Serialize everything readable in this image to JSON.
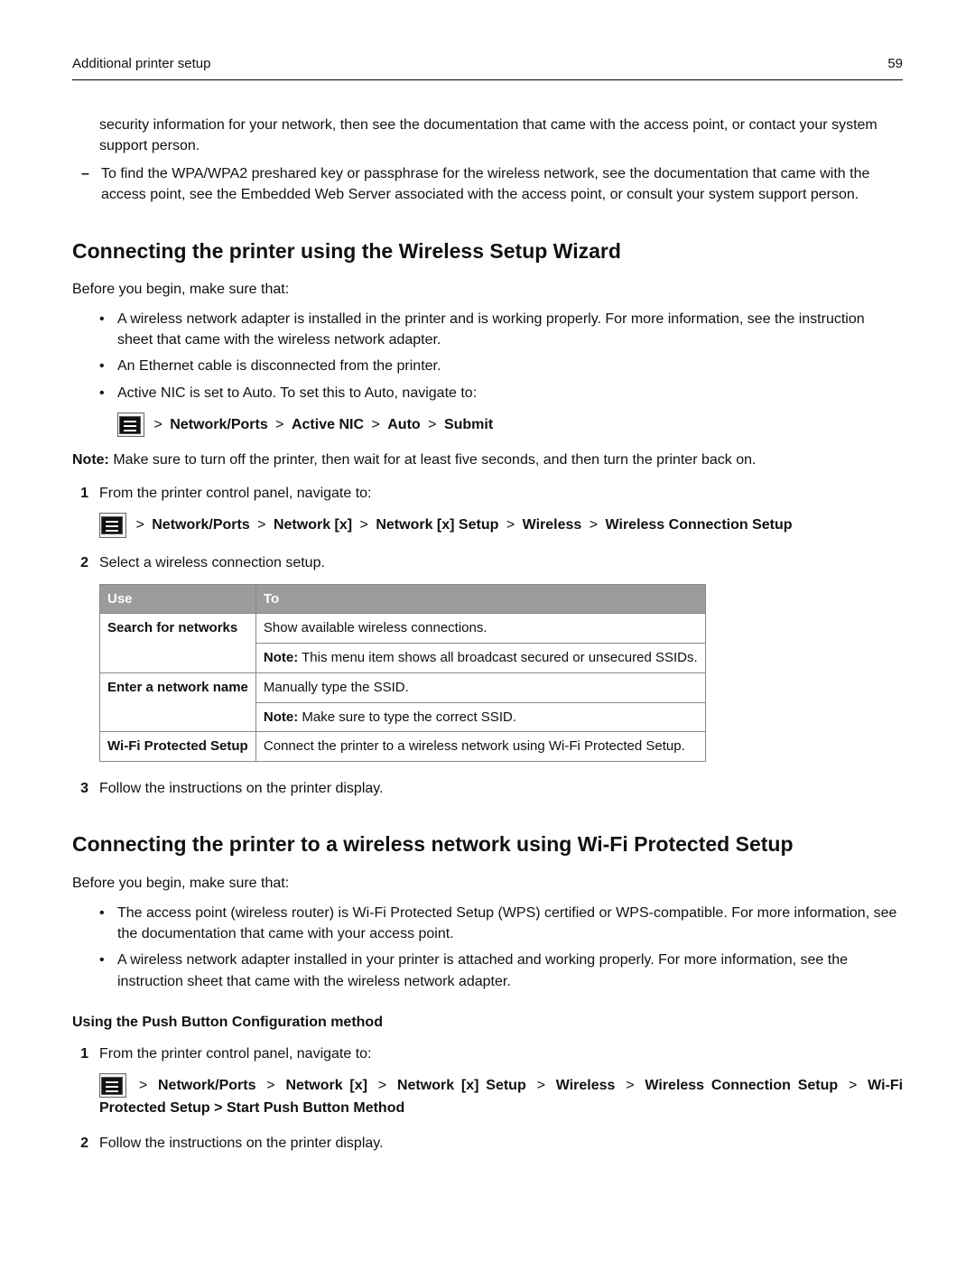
{
  "header": {
    "title": "Additional printer setup",
    "page": "59"
  },
  "intro": {
    "para1": "security information for your network, then see the documentation that came with the access point, or contact your system support person.",
    "dash1": "To find the WPA/WPA2 preshared key or passphrase for the wireless network, see the documentation that came with the access point, see the Embedded Web Server associated with the access point, or consult your system support person."
  },
  "sec1": {
    "heading": "Connecting the printer using the Wireless Setup Wizard",
    "before": "Before you begin, make sure that:",
    "bullets": {
      "b1": "A wireless network adapter is installed in the printer and is working properly. For more information, see the instruction sheet that came with the wireless network adapter.",
      "b2": "An Ethernet cable is disconnected from the printer.",
      "b3": "Active NIC is set to Auto. To set this to Auto, navigate to:"
    },
    "nav1": {
      "p1": "Network/Ports",
      "p2": "Active NIC",
      "p3": "Auto",
      "p4": "Submit"
    },
    "note_label": "Note:",
    "note": " Make sure to turn off the printer, then wait for at least five seconds, and then turn the printer back on.",
    "steps": {
      "s1": "From the printer control panel, navigate to:",
      "s2": "Select a wireless connection setup.",
      "s3": "Follow the instructions on the printer display."
    },
    "nav2": {
      "p1": "Network/Ports",
      "p2": "Network [x]",
      "p3": "Network [x] Setup",
      "p4": "Wireless",
      "p5": "Wireless Connection Setup"
    },
    "table": {
      "h1": "Use",
      "h2": "To",
      "r1c1": "Search for networks",
      "r1c2a": "Show available wireless connections.",
      "r1c2b_label": "Note:",
      "r1c2b": " This menu item shows all broadcast secured or unsecured SSIDs.",
      "r2c1": "Enter a network name",
      "r2c2a": "Manually type the SSID.",
      "r2c2b_label": "Note:",
      "r2c2b": " Make sure to type the correct SSID.",
      "r3c1": "Wi‑Fi Protected Setup",
      "r3c2": "Connect the printer to a wireless network using Wi‑Fi Protected Setup."
    }
  },
  "sec2": {
    "heading": "Connecting the printer to a wireless network using Wi‑Fi Protected Setup",
    "before": "Before you begin, make sure that:",
    "bullets": {
      "b1": "The access point (wireless router) is Wi‑Fi Protected Setup (WPS) certified or WPS‑compatible. For more information, see the documentation that came with your access point.",
      "b2": "A wireless network adapter installed in your printer is attached and working properly. For more information, see the instruction sheet that came with the wireless network adapter."
    },
    "sub": "Using the Push Button Configuration method",
    "steps": {
      "s1": "From the printer control panel, navigate to:",
      "s2": "Follow the instructions on the printer display."
    },
    "nav": {
      "p1": "Network/Ports",
      "p2": "Network [x]",
      "p3": "Network [x] Setup",
      "p4": "Wireless",
      "p5": "Wireless Connection Setup",
      "p6": "Wi‑Fi Protected Setup",
      "p7": "Start Push Button Method"
    }
  },
  "sep": ">"
}
